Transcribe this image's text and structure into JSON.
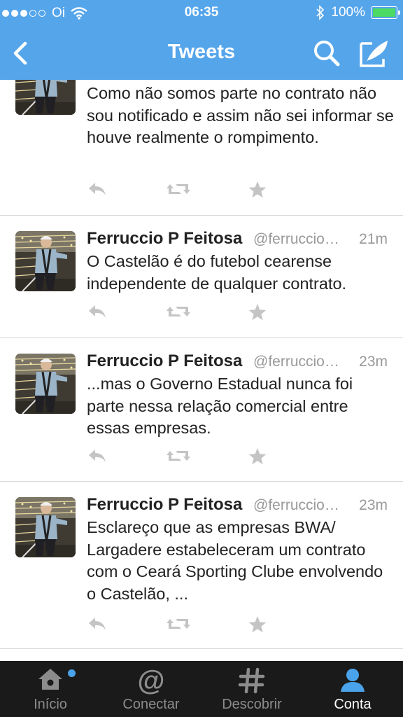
{
  "status_bar": {
    "carrier": "Oi",
    "time": "06:35",
    "battery_percent": "100%",
    "signal_bars_filled": 3,
    "signal_bars_total": 5
  },
  "nav": {
    "title": "Tweets"
  },
  "colors": {
    "header": "#55a5eb",
    "tabbar": "#1a1a1a",
    "accent": "#4aa3ea",
    "battery": "#4cd964"
  },
  "tweets": [
    {
      "name": "",
      "handle": "",
      "time": "",
      "text": "Como não somos parte no contrato não sou notificado e assim não sei informar se houve realmente o rompimento."
    },
    {
      "name": "Ferruccio P Feitosa",
      "handle": "@ferruccio…",
      "time": "21m",
      "text": "O Castelão é do futebol cearense independente de qualquer contrato."
    },
    {
      "name": "Ferruccio P Feitosa",
      "handle": "@ferruccio…",
      "time": "23m",
      "text": "...mas o Governo Estadual nunca foi parte nessa relação comercial entre essas empresas."
    },
    {
      "name": "Ferruccio P Feitosa",
      "handle": "@ferruccio…",
      "time": "23m",
      "text": "Esclareço que as empresas BWA/ Largadere estabeleceram um contrato com o Ceará Sporting Clube envolvendo o Castelão, ..."
    }
  ],
  "tabs": [
    {
      "label": "Início",
      "icon": "home-icon"
    },
    {
      "label": "Conectar",
      "icon": "at-icon"
    },
    {
      "label": "Descobrir",
      "icon": "hashtag-icon"
    },
    {
      "label": "Conta",
      "icon": "person-icon"
    }
  ]
}
